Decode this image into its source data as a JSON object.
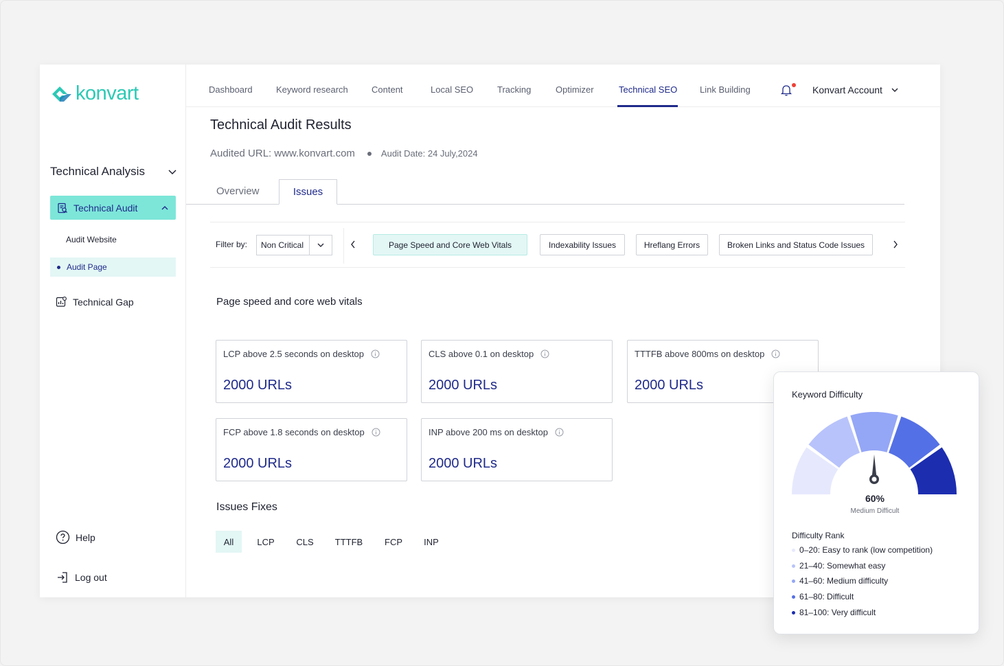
{
  "brand": {
    "name": "konvart",
    "accent": "#2cc9b5",
    "primary": "#1f2a8a"
  },
  "sidebar": {
    "section_title": "Technical Analysis",
    "active_item": "Technical Audit",
    "sub_items": [
      "Audit Website",
      "Audit Page"
    ],
    "technical_gap": "Technical Gap",
    "help": "Help",
    "logout": "Log out"
  },
  "topnav": {
    "items": [
      "Dashboard",
      "Keyword research",
      "Content",
      "Local SEO",
      "Tracking",
      "Optimizer",
      "Technical SEO",
      "Link Building"
    ],
    "active": "Technical SEO",
    "account": "Konvart Account"
  },
  "page": {
    "title": "Technical Audit Results",
    "audited_url": "Audited URL: www.konvart.com",
    "audit_date": "Audit Date: 24 July,2024",
    "tabs": [
      "Overview",
      "Issues"
    ],
    "active_tab": "Issues"
  },
  "filter": {
    "label": "Filter by:",
    "selected": "Non Critical",
    "chips": [
      "Page Speed and Core Web Vitals",
      "Indexability Issues",
      "Hreflang Errors",
      "Broken Links and Status Code Issues"
    ],
    "active_chip": "Page Speed and Core Web Vitals"
  },
  "vitals": {
    "heading": "Page speed and core web vitals",
    "cards": [
      {
        "title": "LCP above 2.5 seconds on desktop",
        "value": "2000 URLs"
      },
      {
        "title": "CLS above 0.1 on desktop",
        "value": "2000 URLs"
      },
      {
        "title": "TTTFB above 800ms on desktop",
        "value": "2000 URLs"
      },
      {
        "title": "FCP above 1.8 seconds on desktop",
        "value": "2000 URLs"
      },
      {
        "title": "INP above 200 ms on desktop",
        "value": "2000 URLs"
      }
    ]
  },
  "fixes": {
    "heading": "Issues Fixes",
    "tabs": [
      "All",
      "LCP",
      "CLS",
      "TTTFB",
      "FCP",
      "INP"
    ],
    "active": "All"
  },
  "keyword_difficulty": {
    "title": "Keyword Difficulty",
    "value": "60%",
    "value_fraction": 0.6,
    "level": "Medium Difficult",
    "rank_title": "Difficulty Rank",
    "ranks": [
      {
        "label": "0–20: Easy to rank (low competition)",
        "color": "#e6e9fd"
      },
      {
        "label": "21–40: Somewhat easy",
        "color": "#b8c3fb"
      },
      {
        "label": "41–60: Medium difficulty",
        "color": "#94a6f6"
      },
      {
        "label": "61–80: Difficult",
        "color": "#5470e6"
      },
      {
        "label": "81–100: Very difficult",
        "color": "#1c2db0"
      }
    ]
  }
}
